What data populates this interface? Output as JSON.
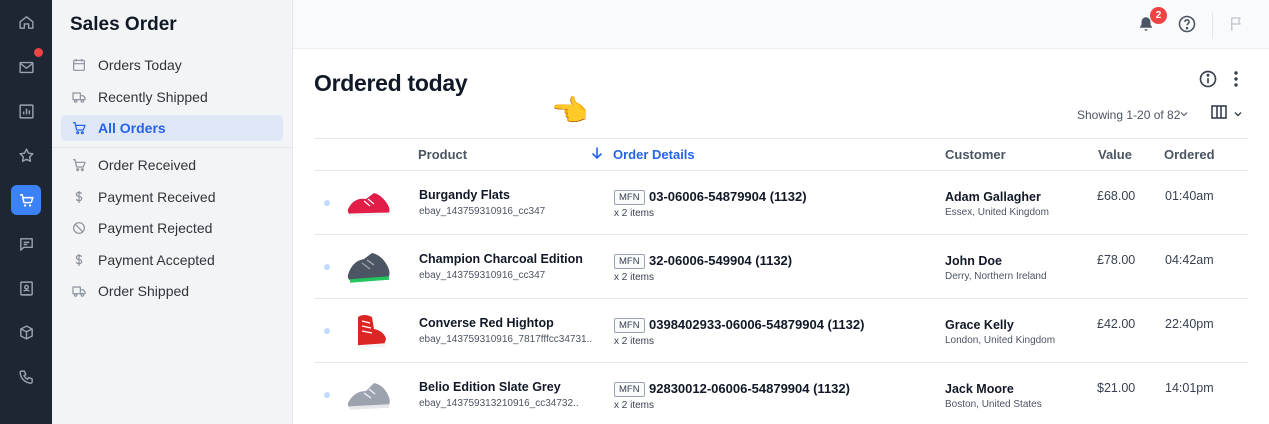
{
  "sidebar": {
    "title": "Sales Order",
    "items": [
      {
        "label": "Orders Today",
        "icon": "calendar-icon"
      },
      {
        "label": "Recently Shipped",
        "icon": "truck-icon"
      },
      {
        "label": "All Orders",
        "icon": "cart-icon",
        "active": true
      },
      {
        "label": "Order Received",
        "icon": "cart-icon"
      },
      {
        "label": "Payment Received",
        "icon": "dollar-icon"
      },
      {
        "label": "Payment Rejected",
        "icon": "ban-icon"
      },
      {
        "label": "Payment Accepted",
        "icon": "dollar-icon"
      },
      {
        "label": "Order Shipped",
        "icon": "truck-icon"
      }
    ]
  },
  "rail": {
    "items": [
      "home-icon",
      "mail-icon",
      "chart-icon",
      "star-icon",
      "cart-icon",
      "message-icon",
      "contact-card-icon",
      "box-icon",
      "phone-icon"
    ],
    "active_index": 4
  },
  "header": {
    "notification_count": "2",
    "icons": [
      "bell-icon",
      "help-icon",
      "flag-icon"
    ]
  },
  "main": {
    "title": "Ordered today",
    "showing": "Showing 1-20 of 82",
    "columns": [
      "Product",
      "Order Details",
      "Customer",
      "Value",
      "Ordered"
    ],
    "sorted_column": "Order Details",
    "rows": [
      {
        "product": "Burgandy Flats",
        "sku": "ebay_143759310916_cc347",
        "tag": "MFN",
        "order_id": "03-06006-54879904 (1132)",
        "qty": "x 2 items",
        "customer": "Adam Gallagher",
        "location": "Essex, United Kingdom",
        "value": "£68.00",
        "time": "01:40am",
        "shoe_color": "#e11d48"
      },
      {
        "product": "Champion Charcoal Edition",
        "sku": "ebay_143759310916_cc347",
        "tag": "MFN",
        "order_id": "32-06006-549904 (1132)",
        "qty": "x 2 items",
        "customer": "John Doe",
        "location": "Derry, Northern Ireland",
        "value": "£78.00",
        "time": "04:42am",
        "shoe_color": "#4b5563"
      },
      {
        "product": "Converse Red Hightop",
        "sku": "ebay_143759310916_7817fffcc34731..",
        "tag": "MFN",
        "order_id": "0398402933-06006-54879904 (1132)",
        "qty": "x 2 items",
        "customer": "Grace Kelly",
        "location": "London, United Kingdom",
        "value": "£42.00",
        "time": "22:40pm",
        "shoe_color": "#dc2626"
      },
      {
        "product": "Belio Edition Slate Grey",
        "sku": "ebay_143759313210916_cc34732..",
        "tag": "MFN",
        "order_id": "92830012-06006-54879904 (1132)",
        "qty": "x 2 items",
        "customer": "Jack Moore",
        "location": "Boston, United States",
        "value": "$21.00",
        "time": "14:01pm",
        "shoe_color": "#9ca3af"
      }
    ]
  },
  "colors": {
    "accent": "#2563eb",
    "rail_bg": "#1e2533",
    "badge": "#ef4444"
  }
}
